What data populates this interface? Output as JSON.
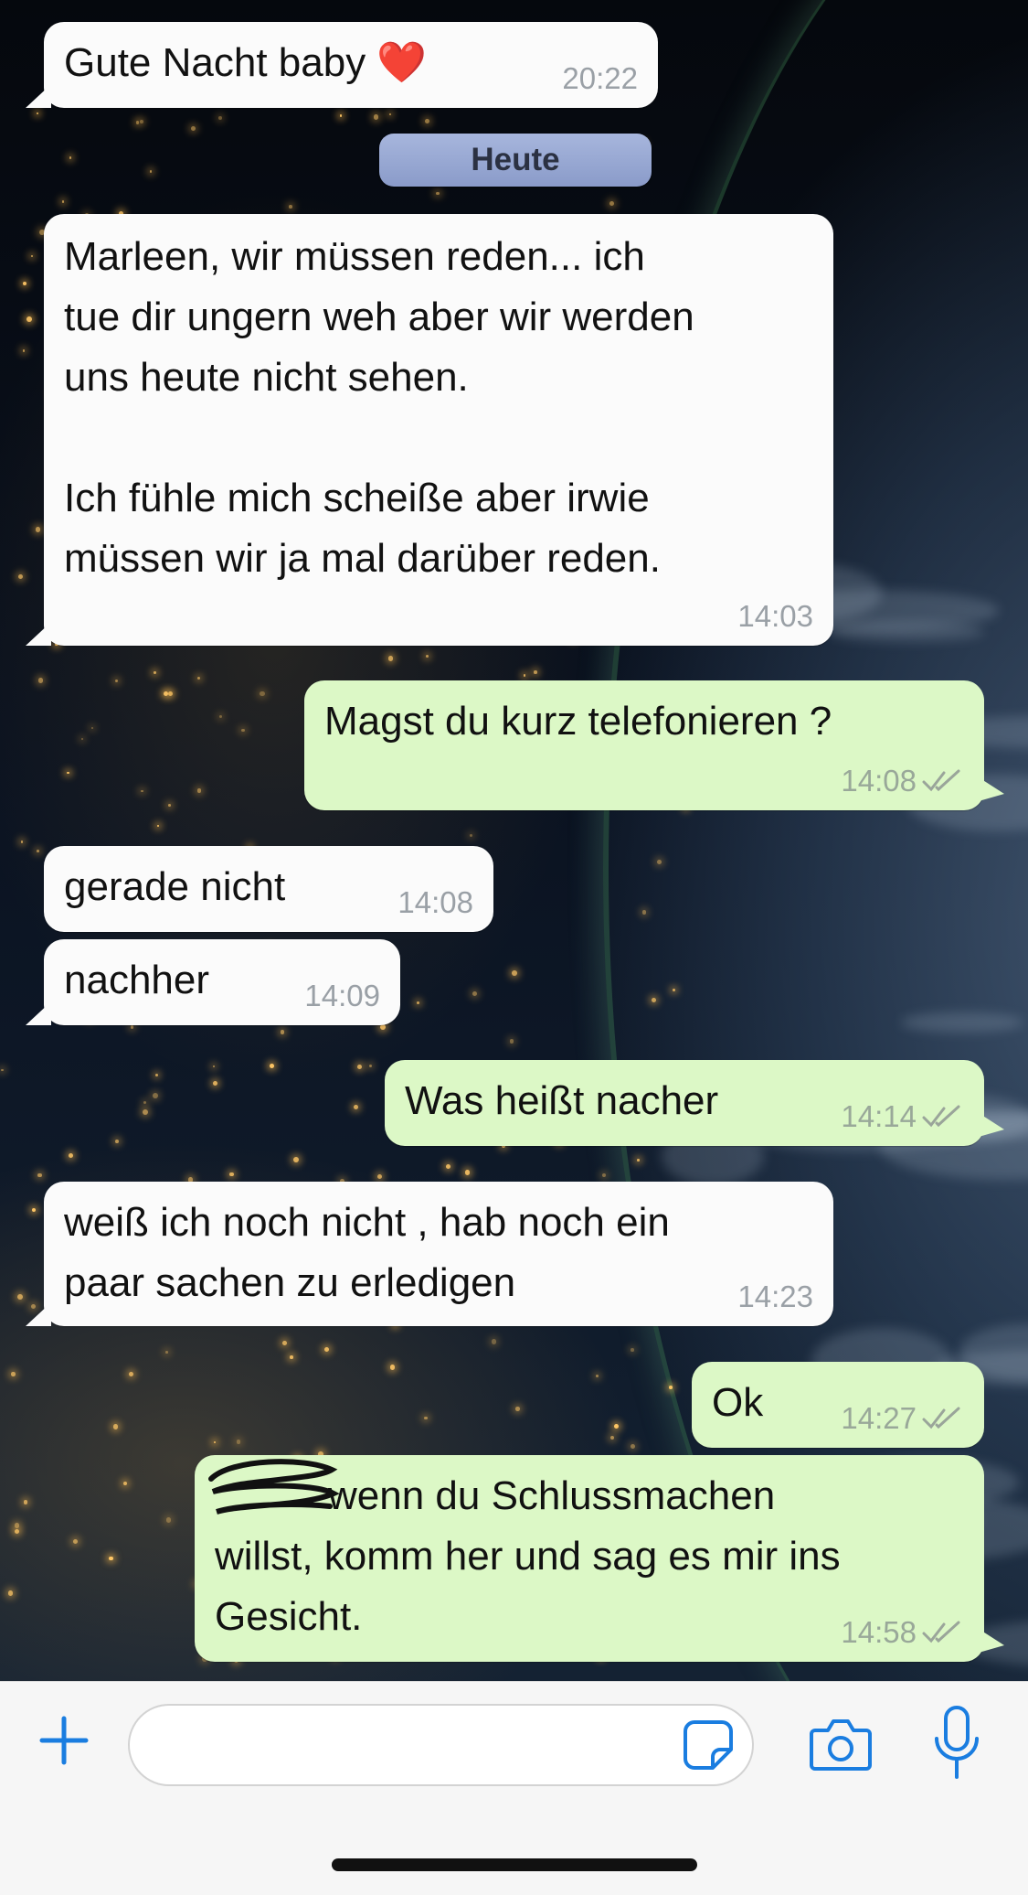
{
  "chat": {
    "date_separator": "Heute",
    "messages": [
      {
        "direction": "in",
        "text": "Gute Nacht baby ❤️",
        "time": "20:22"
      },
      {
        "direction": "in",
        "text": "Marleen, wir müssen reden... ich\ntue dir ungern weh aber wir werden\nuns heute nicht sehen.\n\nIch fühle mich scheiße aber irwie\nmüssen wir ja mal darüber reden.",
        "time": "14:03"
      },
      {
        "direction": "out",
        "text": "Magst du kurz telefonieren ?",
        "time": "14:08",
        "status": "read"
      },
      {
        "direction": "in",
        "text": "gerade nicht",
        "time": "14:08"
      },
      {
        "direction": "in",
        "text": "nachher",
        "time": "14:09"
      },
      {
        "direction": "out",
        "text": "Was heißt nacher",
        "time": "14:14",
        "status": "read"
      },
      {
        "direction": "in",
        "text": "weiß ich noch nicht , hab noch ein\npaar sachen zu erledigen",
        "time": "14:23"
      },
      {
        "direction": "out",
        "text": "Ok",
        "time": "14:27",
        "status": "read"
      },
      {
        "direction": "out",
        "text": "wenn du Schlussmachen\nwillst, komm her und sag es mir ins\nGesicht.",
        "time": "14:58",
        "status": "read",
        "redacted_prefix": true
      }
    ]
  },
  "composer": {
    "input_value": "",
    "icons": [
      "plus-icon",
      "sticker-icon",
      "camera-icon",
      "microphone-icon"
    ],
    "accent_color": "#1a7de0"
  },
  "colors": {
    "incoming_bubble": "#fbfbfb",
    "outgoing_bubble": "#dcf8c6",
    "timestamp": "#9aa0a6"
  }
}
